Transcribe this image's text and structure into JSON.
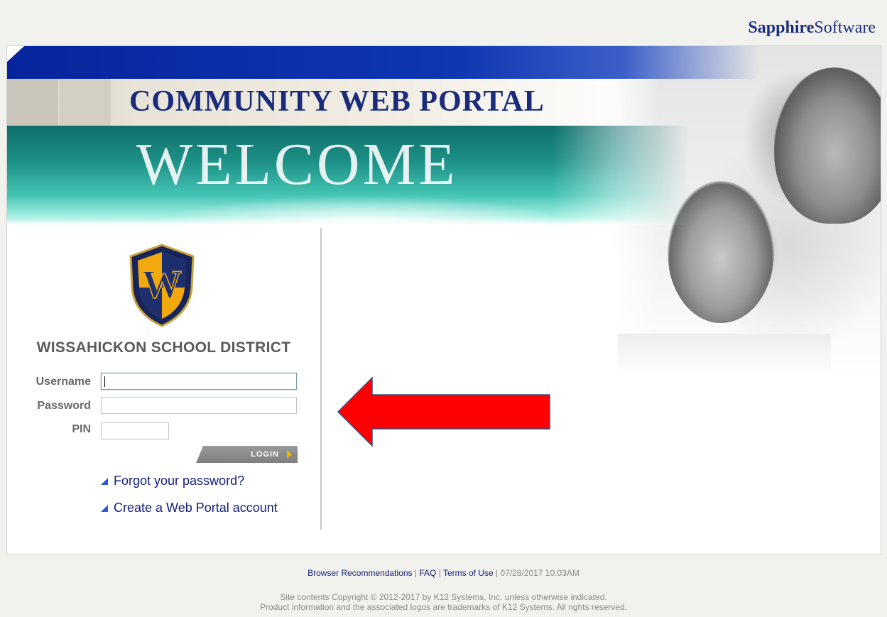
{
  "brand": {
    "bold": "Sapphire",
    "rest": "Software"
  },
  "banner": {
    "portal_title": "COMMUNITY WEB PORTAL",
    "welcome": "WELCOME"
  },
  "district": {
    "name": "WISSAHICKON SCHOOL DISTRICT",
    "crest_letter": "W"
  },
  "login": {
    "username_label": "Username",
    "username_value": "",
    "password_label": "Password",
    "password_value": "",
    "pin_label": "PIN",
    "pin_value": "",
    "button_label": "LOGIN"
  },
  "links": {
    "forgot": "Forgot your password?",
    "create": "Create a Web Portal account"
  },
  "footer": {
    "browser": "Browser Recommendations",
    "faq": "FAQ",
    "terms": "Terms of Use",
    "sep": "|",
    "timestamp": "07/28/2017 10:03AM",
    "copyright_line1": "Site contents Copyright © 2012-2017 by K12 Systems, Inc. unless otherwise indicated.",
    "copyright_line2": "Product information and the associated logos are trademarks of K12 Systems.  All rights reserved."
  },
  "colors": {
    "navy": "#1a2b7c",
    "teal": "#1c8f85",
    "accent_arrow": "#ff0000",
    "link_triangle": "#2a59d8"
  },
  "icons": {
    "login_arrow": "triangle-right-icon",
    "link_bullet": "triangle-icon",
    "pointer": "red-arrow-left-icon"
  }
}
